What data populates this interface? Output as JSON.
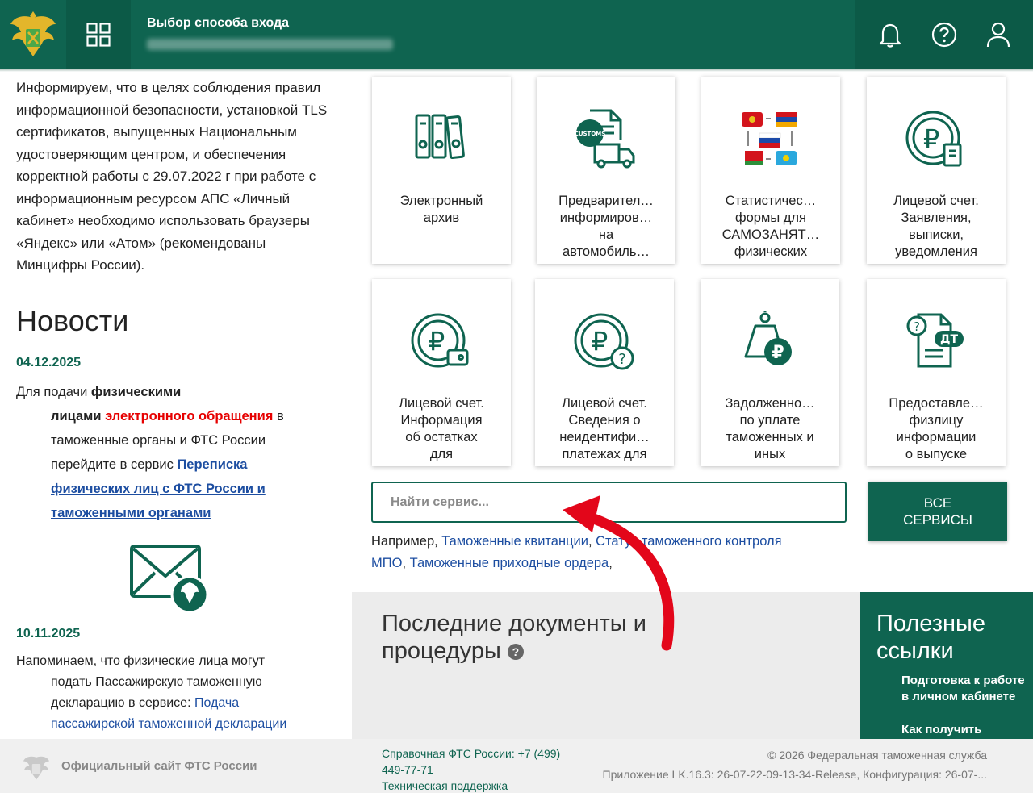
{
  "header": {
    "title": "Выбор способа входа",
    "icons": [
      "emblem-icon",
      "apps-grid-icon",
      "bell-icon",
      "help-circle-icon",
      "user-icon"
    ]
  },
  "info_text": "Информируем, что в целях соблюдения правил информационной безопасности, установкой TLS сертификатов, выпущенных Национальным удостоверяющим центром, и обеспечения корректной работы с 29.07.2022 г при работе с информационным ресурсом АПС «Личный кабинет» необходимо использовать браузеры «Яндекс» или «Атом» (рекомендованы Минцифры России).",
  "news": {
    "heading": "Новости",
    "item1": {
      "date": "04.12.2025",
      "t1": "Для подачи ",
      "t2": "физическими",
      "t3": "лицами",
      "t4": " ",
      "t5": "электронного обращения",
      "t6": " в",
      "t7": "таможенные органы и ФТС России",
      "t8": "перейдите в сервис ",
      "link1": "Переписка",
      "link2": "физических лиц с ФТС России и",
      "link3": "таможенными органами"
    },
    "item2": {
      "date": "10.11.2025",
      "t1": "Напоминаем, что физические лица могут",
      "t2": "подать Пассажирскую таможенную",
      "t3": "декларацию в сервисе: ",
      "link1": "Подача",
      "link2": "пассажирской таможенной декларации"
    }
  },
  "tiles": [
    {
      "l1": "Электронный",
      "l2": "архив",
      "l3": "",
      "l4": ""
    },
    {
      "l1": "Предварител…",
      "l2": "информиров…",
      "l3": "на",
      "l4": "автомобиль…"
    },
    {
      "l1": "Статистичес…",
      "l2": "формы для",
      "l3": "САМОЗАНЯТ…",
      "l4": "физических"
    },
    {
      "l1": "Лицевой счет.",
      "l2": "Заявления,",
      "l3": "выписки,",
      "l4": "уведомления"
    },
    {
      "l1": "Лицевой счет.",
      "l2": "Информация",
      "l3": "об остатках",
      "l4": "для"
    },
    {
      "l1": "Лицевой счет.",
      "l2": "Сведения о",
      "l3": "неидентифи…",
      "l4": "платежах для"
    },
    {
      "l1": "Задолженно…",
      "l2": "по уплате",
      "l3": "таможенных и",
      "l4": "иных"
    },
    {
      "l1": "Предоставле…",
      "l2": "физлицу",
      "l3": "информации",
      "l4": "о выпуске"
    }
  ],
  "tile_badges": {
    "customs": "CUSTOMS",
    "dt": "ДТ",
    "ruble": "₽",
    "question": "?"
  },
  "search": {
    "placeholder": "Найти сервис...",
    "all_services_l1": "ВСЕ",
    "all_services_l2": "СЕРВИСЫ",
    "examples_prefix": "Например, ",
    "ex1": "Таможенные квитанции",
    "sep1": ", ",
    "ex2": "Статус таможенного контроля",
    "ex2b": "МПО",
    "sep2": ", ",
    "ex3": "Таможенные приходные ордера",
    "sep3": ","
  },
  "docs": {
    "title_l1": "Последние документы и",
    "title_l2": "процедуры",
    "help": "?"
  },
  "useful": {
    "title_l1": "Полезные",
    "title_l2": "ссылки",
    "item1": "Подготовка к работе в личном кабинете",
    "item2": "Как получить"
  },
  "footer": {
    "site": "Официальный сайт ФТС России",
    "phone_l1": "Справочная ФТС России: +7 (499)",
    "phone_l2": "449-77-71",
    "support": "Техническая поддержка",
    "copyright": "© 2026 Федеральная таможенная служба",
    "version": "Приложение LK.16.3: 26-07-22-09-13-34-Release, Конфигурация: 26-07-..."
  },
  "colors": {
    "brand_green": "#0f6450",
    "link_blue": "#1d4ea1",
    "alert_red": "#e60000",
    "arrow_red": "#e3061a"
  }
}
